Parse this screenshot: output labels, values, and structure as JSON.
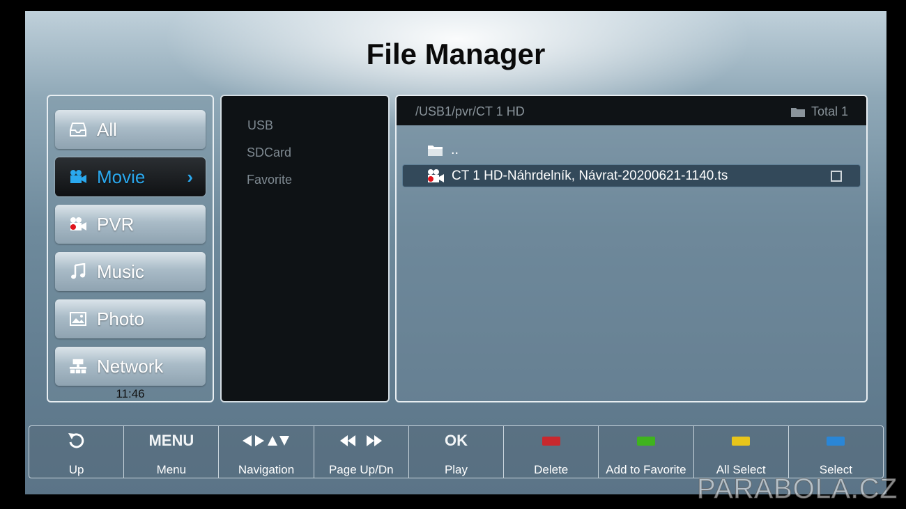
{
  "title": "File Manager",
  "categories": [
    {
      "label": "All",
      "icon": "drive-icon",
      "selected": false
    },
    {
      "label": "Movie",
      "icon": "movie-camera-icon",
      "selected": true
    },
    {
      "label": "PVR",
      "icon": "pvr-record-icon",
      "selected": false
    },
    {
      "label": "Music",
      "icon": "music-note-icon",
      "selected": false
    },
    {
      "label": "Photo",
      "icon": "photo-icon",
      "selected": false
    },
    {
      "label": "Network",
      "icon": "network-icon",
      "selected": false
    }
  ],
  "clock": "11:46",
  "sources": [
    "USB",
    "SDCard",
    "Favorite"
  ],
  "browser": {
    "path": "/USB1/pvr/CT 1 HD",
    "total": "Total 1",
    "up_label": "..",
    "files": [
      {
        "name": "CT 1 HD-Náhrdelník, Návrat-20200621-1140.ts",
        "checked": false
      }
    ]
  },
  "toolbar": [
    {
      "top": "",
      "icon": "return-icon",
      "label": "Up"
    },
    {
      "top": "MENU",
      "icon": "",
      "label": "Menu"
    },
    {
      "top": "◀▶▲▼",
      "icon": "arrows-icon",
      "label": "Navigation"
    },
    {
      "top": "◀◀ ▶▶",
      "icon": "page-arrows-icon",
      "label": "Page Up/Dn"
    },
    {
      "top": "OK",
      "icon": "",
      "label": "Play"
    },
    {
      "top": "",
      "icon": "red-key",
      "label": "Delete",
      "color": "#c8282e"
    },
    {
      "top": "",
      "icon": "green-key",
      "label": "Add to Favorite",
      "color": "#3fb31e"
    },
    {
      "top": "",
      "icon": "yellow-key",
      "label": "All Select",
      "color": "#e8c51a"
    },
    {
      "top": "",
      "icon": "blue-key",
      "label": "Select",
      "color": "#2a86d6"
    }
  ],
  "watermark": "PARABOLA.CZ"
}
